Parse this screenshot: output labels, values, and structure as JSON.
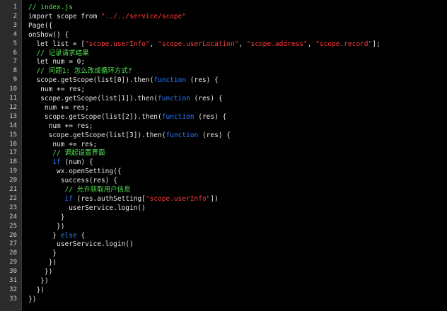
{
  "editor": {
    "line_numbers": [
      "1",
      "2",
      "3",
      "4",
      "5",
      "6",
      "7",
      "8",
      "9",
      "10",
      "11",
      "12",
      "13",
      "14",
      "15",
      "16",
      "17",
      "18",
      "19",
      "20",
      "21",
      "22",
      "23",
      "24",
      "25",
      "26",
      "27",
      "28",
      "29",
      "30",
      "31",
      "32",
      "33"
    ],
    "lines": [
      [
        {
          "t": "cm",
          "v": "// index.js"
        }
      ],
      [
        {
          "t": "pl",
          "v": "import scope from "
        },
        {
          "t": "str",
          "v": "\"../../service/scope\""
        }
      ],
      [
        {
          "t": "pl",
          "v": "Page({"
        }
      ],
      [
        {
          "t": "pl",
          "v": "onShow() {"
        }
      ],
      [
        {
          "t": "pl",
          "v": "  let list = ["
        },
        {
          "t": "str",
          "v": "\"scope.userInfo\""
        },
        {
          "t": "pl",
          "v": ", "
        },
        {
          "t": "str",
          "v": "\"scope.userLocation\""
        },
        {
          "t": "pl",
          "v": ", "
        },
        {
          "t": "str",
          "v": "\"scope.address\""
        },
        {
          "t": "pl",
          "v": ", "
        },
        {
          "t": "str",
          "v": "\"scope.record\""
        },
        {
          "t": "pl",
          "v": "];"
        }
      ],
      [
        {
          "t": "cm",
          "v": "  // 记录请求结果"
        }
      ],
      [
        {
          "t": "pl",
          "v": "  let num = 0;"
        }
      ],
      [
        {
          "t": "cm",
          "v": "  // 问题1: 怎么改成循环方式?"
        }
      ],
      [
        {
          "t": "pl",
          "v": "  scope.getScope(list[0]).then("
        },
        {
          "t": "kw",
          "v": "function"
        },
        {
          "t": "pl",
          "v": " (res) {"
        }
      ],
      [
        {
          "t": "pl",
          "v": "   num += res;"
        }
      ],
      [
        {
          "t": "pl",
          "v": "   scope.getScope(list[1]).then("
        },
        {
          "t": "kw",
          "v": "function"
        },
        {
          "t": "pl",
          "v": " (res) {"
        }
      ],
      [
        {
          "t": "pl",
          "v": "    num += res;"
        }
      ],
      [
        {
          "t": "pl",
          "v": "    scope.getScope(list[2]).then("
        },
        {
          "t": "kw",
          "v": "function"
        },
        {
          "t": "pl",
          "v": " (res) {"
        }
      ],
      [
        {
          "t": "pl",
          "v": "     num += res;"
        }
      ],
      [
        {
          "t": "pl",
          "v": "     scope.getScope(list[3]).then("
        },
        {
          "t": "kw",
          "v": "function"
        },
        {
          "t": "pl",
          "v": " (res) {"
        }
      ],
      [
        {
          "t": "pl",
          "v": "      num += res;"
        }
      ],
      [
        {
          "t": "cm",
          "v": "      // 调起设置界面"
        }
      ],
      [
        {
          "t": "pl",
          "v": "      "
        },
        {
          "t": "kw",
          "v": "if"
        },
        {
          "t": "pl",
          "v": " (num) {"
        }
      ],
      [
        {
          "t": "pl",
          "v": "       wx.openSetting({"
        }
      ],
      [
        {
          "t": "pl",
          "v": "        success(res) {"
        }
      ],
      [
        {
          "t": "cm",
          "v": "         // 允许获取用户信息"
        }
      ],
      [
        {
          "t": "pl",
          "v": "         "
        },
        {
          "t": "kw",
          "v": "if"
        },
        {
          "t": "pl",
          "v": " (res.authSetting["
        },
        {
          "t": "str",
          "v": "\"scope.userInfo\""
        },
        {
          "t": "pl",
          "v": "])"
        }
      ],
      [
        {
          "t": "pl",
          "v": "          userService.login()"
        }
      ],
      [
        {
          "t": "pl",
          "v": "        }"
        }
      ],
      [
        {
          "t": "pl",
          "v": "       })"
        }
      ],
      [
        {
          "t": "pl",
          "v": "      } "
        },
        {
          "t": "kw",
          "v": "else"
        },
        {
          "t": "pl",
          "v": " {"
        }
      ],
      [
        {
          "t": "pl",
          "v": "       userService.login()"
        }
      ],
      [
        {
          "t": "pl",
          "v": "      }"
        }
      ],
      [
        {
          "t": "pl",
          "v": "     })"
        }
      ],
      [
        {
          "t": "pl",
          "v": "    })"
        }
      ],
      [
        {
          "t": "pl",
          "v": "   })"
        }
      ],
      [
        {
          "t": "pl",
          "v": "  })"
        }
      ],
      [
        {
          "t": "pl",
          "v": "})"
        }
      ]
    ]
  },
  "colors": {
    "background": "#000000",
    "gutter": "#2b2b2b",
    "comment": "#54e654",
    "string": "#ff3b3b",
    "keyword": "#2f7cff",
    "text": "#e8e8e8"
  }
}
